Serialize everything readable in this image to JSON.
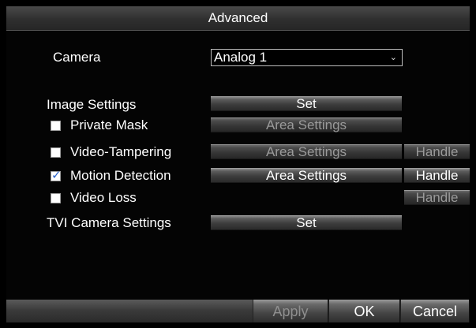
{
  "dialog": {
    "title": "Advanced"
  },
  "camera": {
    "label": "Camera",
    "selected": "Analog 1",
    "arrow_icon": "chevron-down-icon"
  },
  "rows": {
    "image_settings": {
      "label": "Image Settings",
      "button": "Set"
    },
    "private_mask": {
      "label": "Private Mask",
      "checked": false,
      "button": "Area Settings"
    },
    "video_tampering": {
      "label": "Video-Tampering",
      "checked": false,
      "button": "Area Settings",
      "handle": "Handle"
    },
    "motion_detection": {
      "label": "Motion Detection",
      "checked": true,
      "button": "Area Settings",
      "handle": "Handle",
      "check_mark": "✓"
    },
    "video_loss": {
      "label": "Video Loss",
      "checked": false,
      "handle": "Handle"
    },
    "tvi_camera_settings": {
      "label": "TVI Camera Settings",
      "button": "Set"
    }
  },
  "footer": {
    "apply": "Apply",
    "ok": "OK",
    "cancel": "Cancel"
  },
  "colors": {
    "check_accent": "#2a62c9",
    "background": "#040404",
    "bar_gray": "#3b3b3b"
  }
}
